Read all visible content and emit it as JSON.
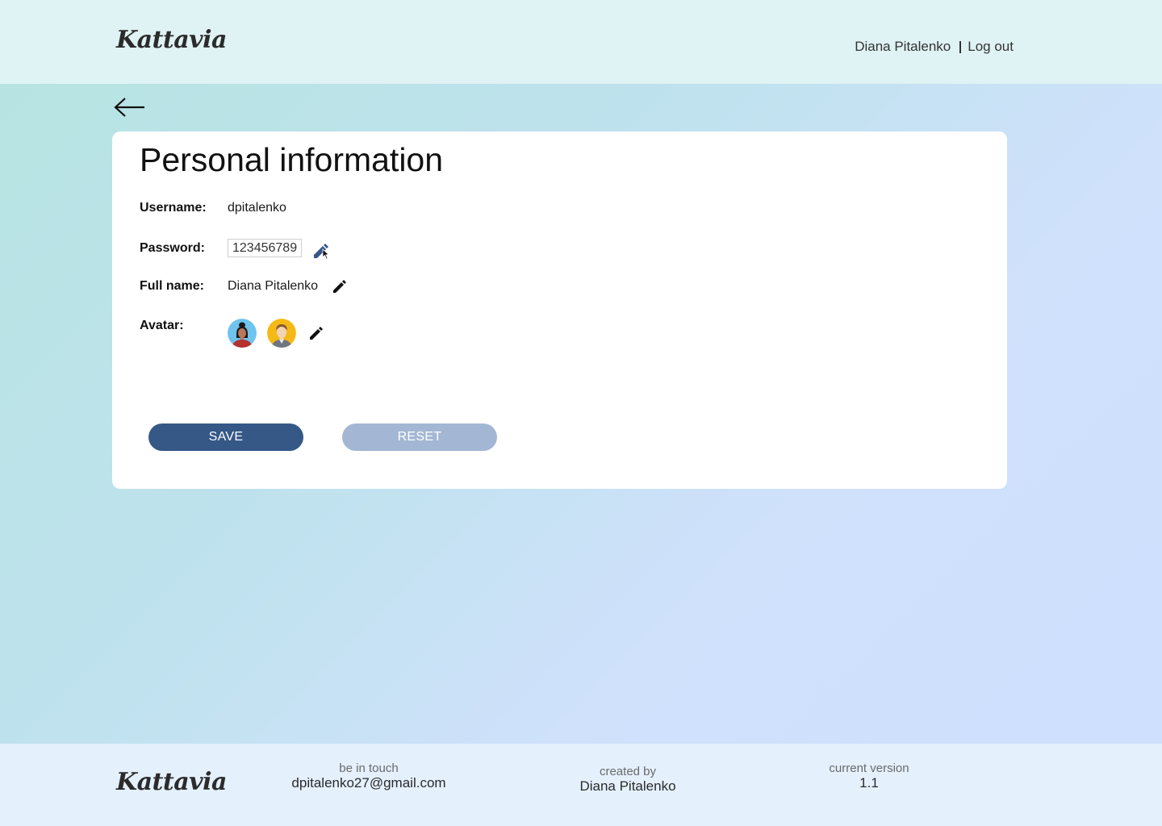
{
  "header": {
    "logo_text": "Kattavia",
    "user_name": "Diana Pitalenko",
    "logout_label": "Log out"
  },
  "page": {
    "title": "Personal information",
    "back_icon": "arrow-left-icon"
  },
  "form": {
    "username": {
      "label": "Username:",
      "value": "dpitalenko"
    },
    "password": {
      "label": "Password:",
      "value": "123456789"
    },
    "full_name": {
      "label": "Full name:",
      "value": "Diana Pitalenko"
    },
    "avatar": {
      "label": "Avatar:",
      "options": [
        "woman-avatar",
        "man-avatar"
      ]
    },
    "edit_icon": "pencil-icon"
  },
  "buttons": {
    "save_label": "SAVE",
    "reset_label": "RESET"
  },
  "footer": {
    "logo_text": "Kattavia",
    "contact_caption": "be in touch",
    "contact_email": "dpitalenko27@gmail.com",
    "author_caption": "created by",
    "author_name": "Diana Pitalenko",
    "version_caption": "current version",
    "version_value": "1.1"
  },
  "colors": {
    "primary": "#355887",
    "primary_disabled": "#a3b7d4",
    "header_bg": "#dff2f4",
    "footer_bg": "#e4f0fc"
  }
}
